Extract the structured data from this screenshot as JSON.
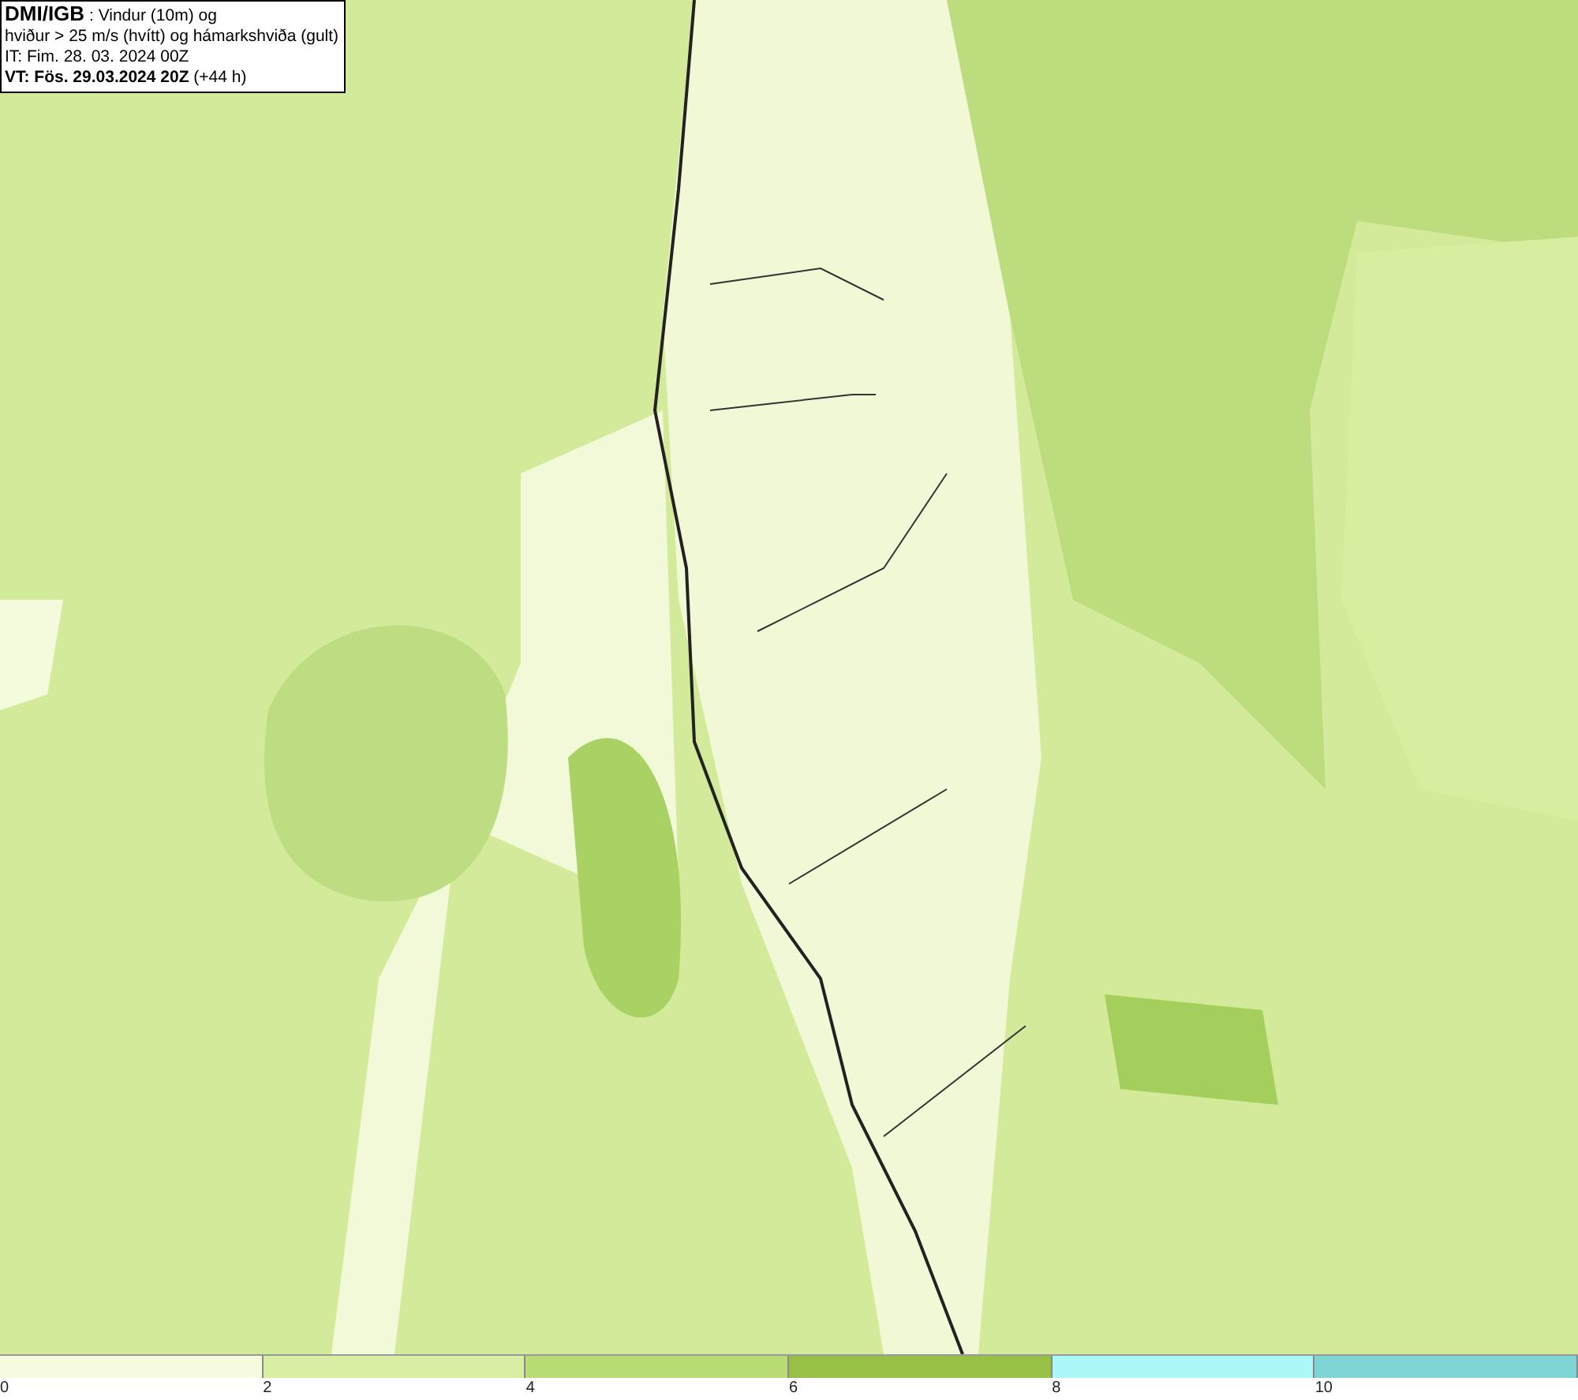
{
  "title_box": {
    "lines": [
      "**DMI/IGB** : Vindur (10m) og",
      "hviður > 25 m/s (hvítt) og hámarkshviða (gult)",
      "IT: Fim. 28. 03. 2024 00Z",
      "**VT: Fös. 29.03.2024 20Z** (+44 h)"
    ]
  },
  "legend": {
    "bins": [
      {
        "label": "0",
        "color": "#f6fbdf"
      },
      {
        "label": "2",
        "color": "#d9eea2"
      },
      {
        "label": "4",
        "color": "#b8db74"
      },
      {
        "label": "6",
        "color": "#98c046"
      },
      {
        "label": "8",
        "color": "#aaf8f8"
      },
      {
        "label": "10",
        "color": "#7fd4d6"
      }
    ]
  }
}
